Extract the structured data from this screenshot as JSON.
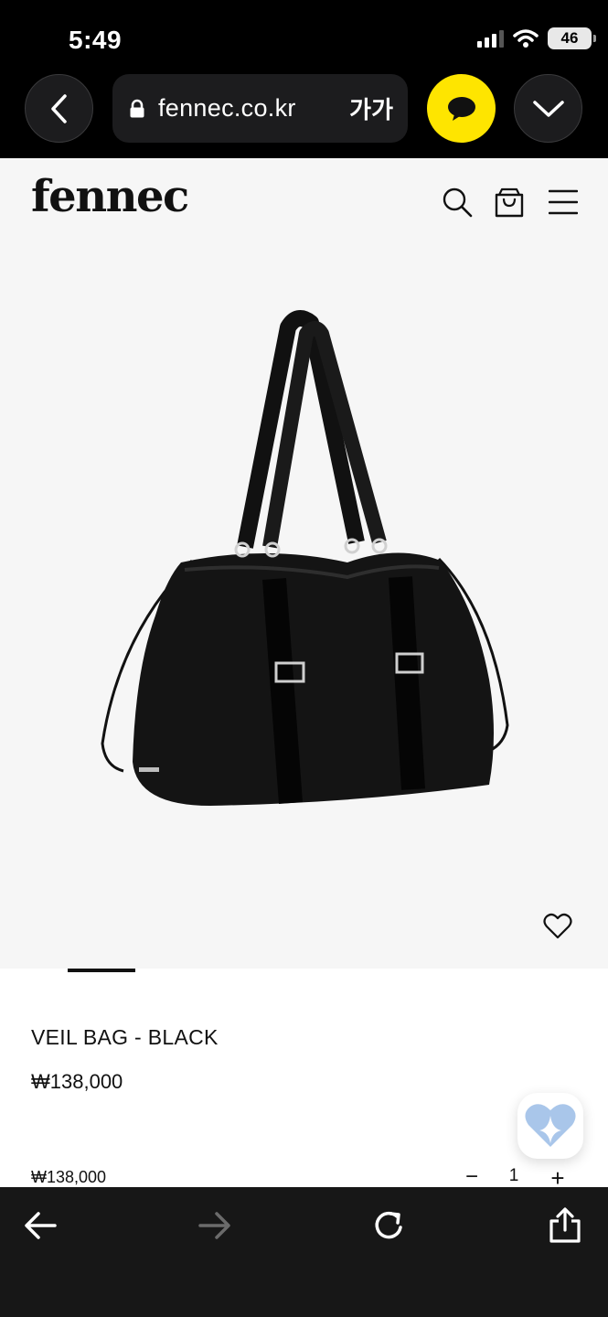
{
  "status_bar": {
    "time": "5:49",
    "battery": "46",
    "icons": [
      "cellular-signal-icon",
      "wifi-icon",
      "battery-icon"
    ]
  },
  "browser": {
    "url": "fennec.co.kr",
    "text_size_label": "가가",
    "icons": [
      "back-icon",
      "lock-icon",
      "kakao-chat-icon",
      "chevron-down-icon"
    ],
    "accent_color": "#fee500"
  },
  "site": {
    "logo": "fennec",
    "header_icons": [
      "search-icon",
      "shopping-bag-icon",
      "menu-icon"
    ]
  },
  "product": {
    "name": "VEIL BAG - BLACK",
    "price": "₩138,000",
    "image_icon": "tote-bag-image",
    "wishlist_icon": "heart-icon"
  },
  "option": {
    "price": "₩138,000",
    "minus": "−",
    "quantity": "1",
    "plus": "+"
  },
  "toolbar": {
    "icons": [
      "back-arrow-icon",
      "forward-arrow-icon",
      "reload-icon",
      "share-icon"
    ]
  }
}
